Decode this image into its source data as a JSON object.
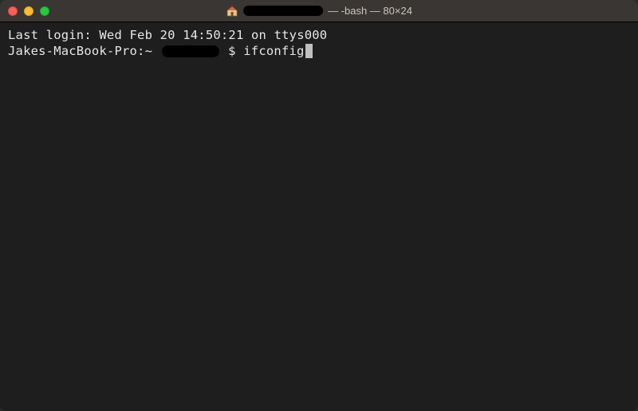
{
  "titlebar": {
    "title_suffix": " — -bash — 80×24"
  },
  "terminal": {
    "last_login_line": "Last login: Wed Feb 20 14:50:21 on ttys000",
    "prompt_prefix": "Jakes-MacBook-Pro:~ ",
    "prompt_symbol": " $ ",
    "command": "ifconfig"
  }
}
